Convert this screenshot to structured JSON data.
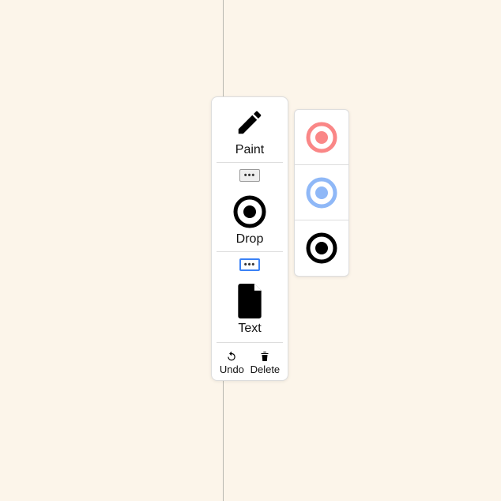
{
  "tools": {
    "paint": {
      "label": "Paint"
    },
    "drop": {
      "label": "Drop"
    },
    "text": {
      "label": "Text"
    }
  },
  "buttons": {
    "more1": "•••",
    "more2": "•••",
    "undo": "Undo",
    "delete": "Delete"
  },
  "colors": {
    "red": "#fa8787",
    "blue": "#8fb8f7",
    "black": "#000000"
  }
}
